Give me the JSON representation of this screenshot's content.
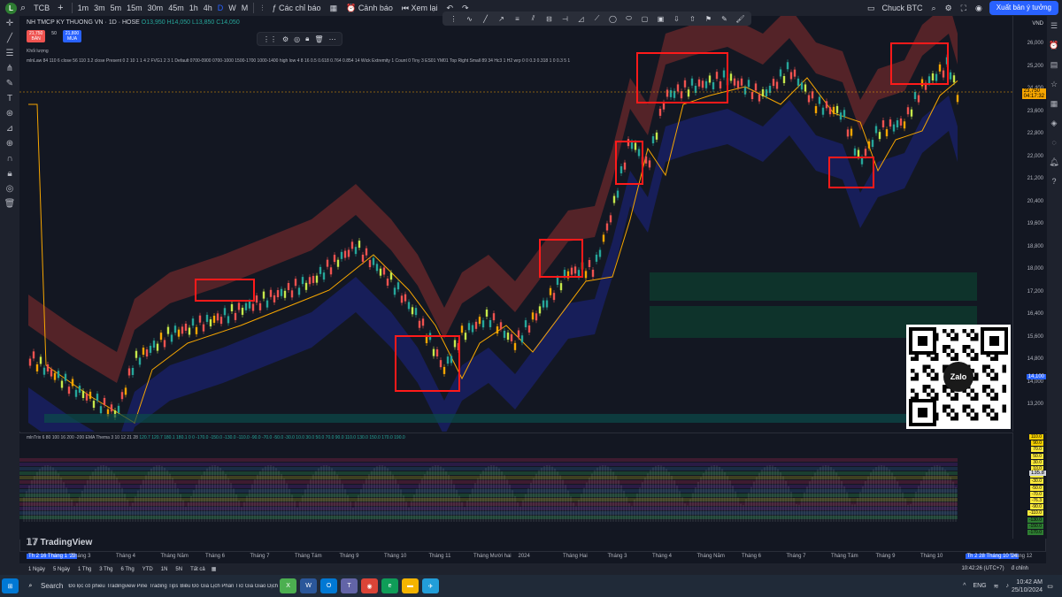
{
  "topbar": {
    "symbol": "TCB",
    "intervals": [
      "1m",
      "3m",
      "5m",
      "15m",
      "30m",
      "45m",
      "1h",
      "4h",
      "D",
      "W",
      "M"
    ],
    "active_interval": "D",
    "indicators_label": "Các chỉ báo",
    "alerts_label": "Cảnh báo",
    "replay_label": "Xem lại",
    "layout_name": "Chuck BTC",
    "publish_label": "Xuất bản ý tưởng"
  },
  "legend": {
    "title": "NH TMCP KY THUONG VN · 1D · HOSE",
    "ohlc": "O13,950 H14,050 L13,850 C14,050",
    "sell_price": "21,750",
    "sell_label": "BÁN",
    "spread": "50",
    "buy_price": "21,800",
    "buy_label": "MUA",
    "volume_label": "Khối lượng",
    "indicator_line": "mlnLaw 84 110 6 close 56 110 3.2 close Present 0 2 10 1 1 4 2 FVG1 2 3 1 Default 0700-0900 0700-1000 1500-1700 1000-1400 high low 4 8 16 0.5 0.618 0.764 0.854 14 Wick Extremity 1 Count 0 Tiny 3 ES01 YM01 Top Right Small 89 34 Hc3 1 H2 wrp 0 0 0.3 0.318 1 0 0.3 5 1",
    "osc_line": "mlnTrix 6 80 100 16 200 -200 EMA Thema 3 10 12 21 28",
    "osc_values": "120.7  120.7  180.1  180.1  0  0  -170.0  -150.0  -130.0  -110.0  -90.0  -70.0  -50.0  -30.0  10.0  30.0  50.0  70.0  90.0  110.0  130.0  150.0  170.0  190.0"
  },
  "price_axis": {
    "currency": "VND",
    "labels": [
      "26,000",
      "25,200",
      "24,400",
      "23,600",
      "22,800",
      "22,000",
      "21,200",
      "20,400",
      "19,600",
      "18,800",
      "18,000",
      "17,200",
      "16,400",
      "15,600",
      "14,800",
      "14,000",
      "13,200"
    ],
    "last_price": "23,750",
    "last_time": "04:17:32",
    "cursor_price": "14,100"
  },
  "osc_axis": {
    "labels": [
      "110.0",
      "90.0",
      "70.0",
      "50.0",
      "30.0",
      "10.0",
      "-10.0",
      "-30.0",
      "-50.0",
      "-70.0",
      "-76.3",
      "-90.0",
      "-110.0",
      "-130.0",
      "-150.0",
      "-170.0"
    ],
    "marker": "135.8"
  },
  "time_axis": {
    "labels": [
      "Th 2 16 Tháng 1 '23",
      "Tháng 3",
      "Tháng 4",
      "Tháng Năm",
      "Tháng 6",
      "Tháng 7",
      "Tháng Tám",
      "Tháng 9",
      "Tháng 10",
      "Tháng 11",
      "Tháng Mười hai",
      "2024",
      "Tháng Hai",
      "Tháng 3",
      "Tháng 4",
      "Tháng Năm",
      "Tháng 6",
      "Tháng 7",
      "Tháng Tám",
      "Tháng 9",
      "Tháng 10",
      "Th 2 28 Tháng 10 '24",
      "Tháng 12"
    ]
  },
  "range_bar": {
    "ranges": [
      "1 Ngày",
      "5 Ngày",
      "1 Thg",
      "3 Thg",
      "6 Thg",
      "YTD",
      "1N",
      "5N",
      "Tất cả"
    ],
    "time": "10:42:26 (UTC+7)",
    "adjust": "đ chỉnh"
  },
  "taskbar": {
    "search": "Search",
    "lang": "ENG",
    "time": "10:42 AM",
    "date": "25/10/2024",
    "apps": [
      "Đồ lọc cổ phiếu",
      "Tradingview Pine",
      "Trading Tips",
      "Biểu Đồ",
      "Giá Lịch Phân Tích",
      "Giá Giao Dịch"
    ]
  },
  "watermark": "TradingView",
  "qr_label": "Zalo",
  "colors": {
    "up": "#26a69a",
    "down": "#ef5350",
    "accent": "#2962ff",
    "box": "#ff1a1a",
    "band_upper": "#8b2e2e",
    "band_lower": "#1a237e"
  }
}
